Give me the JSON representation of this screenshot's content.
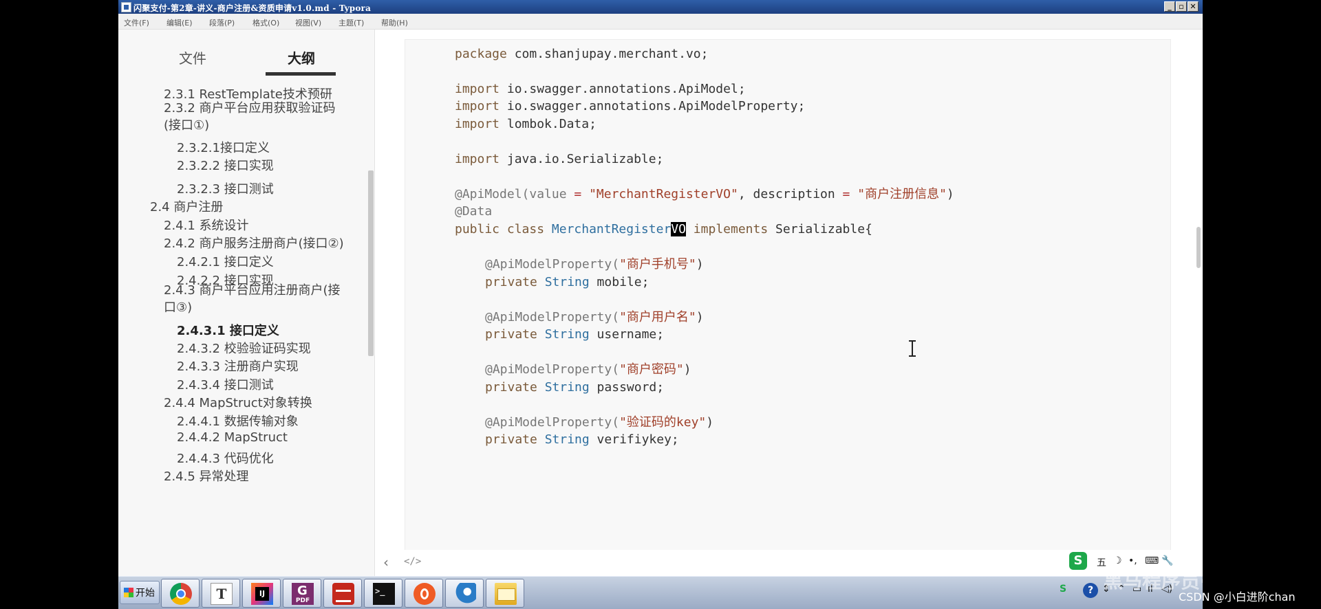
{
  "window": {
    "title": "闪聚支付-第2章-讲义-商户注册&资质申请v1.0.md - Typora",
    "controls": [
      "_",
      "▫",
      "✕"
    ]
  },
  "menu": [
    "文件(F)",
    "编辑(E)",
    "段落(P)",
    "格式(O)",
    "视图(V)",
    "主题(T)",
    "帮助(H)"
  ],
  "sidebar": {
    "tab_files": "文件",
    "tab_outline": "大纲",
    "items": [
      {
        "label": "2.3.1 RestTemplate技术预研"
      },
      {
        "label": "2.3.2 商户平台应用获取验证码(接口①)"
      },
      {
        "label": "2.3.2.1接口定义"
      },
      {
        "label": "2.3.2.2 接口实现"
      },
      {
        "label": "2.3.2.3 接口测试"
      },
      {
        "label": "2.4 商户注册"
      },
      {
        "label": "2.4.1 系统设计"
      },
      {
        "label": "2.4.2 商户服务注册商户(接口②)"
      },
      {
        "label": "2.4.2.1 接口定义"
      },
      {
        "label": "2.4.2.2 接口实现"
      },
      {
        "label": "2.4.3 商户平台应用注册商户(接口③)"
      },
      {
        "label": "2.4.3.1 接口定义",
        "active": true
      },
      {
        "label": "2.4.3.2 校验验证码实现"
      },
      {
        "label": "2.4.3.3 注册商户实现"
      },
      {
        "label": "2.4.3.4 接口测试"
      },
      {
        "label": "2.4.4 MapStruct对象转换"
      },
      {
        "label": "2.4.4.1 数据传输对象"
      },
      {
        "label": "2.4.4.2 MapStruct"
      },
      {
        "label": "2.4.4.3 代码优化"
      },
      {
        "label": "2.4.5 异常处理"
      }
    ]
  },
  "code": {
    "package_kw": "package",
    "package_name": " com.shanjupay.merchant.vo;",
    "import_kw": "import",
    "imports": [
      " io.swagger.annotations.ApiModel;",
      " io.swagger.annotations.ApiModelProperty;",
      " lombok.Data;",
      " java.io.Serializable;"
    ],
    "api_model_annotation": "@ApiModel(value ",
    "eq": "=",
    "api_model_value": "\"MerchantRegisterVO\"",
    "api_model_mid": ", description ",
    "api_model_desc": "\"商户注册信息\"",
    "close_paren": ")",
    "data_annotation": "@Data",
    "class_public": "public",
    "class_kw": " class ",
    "class_name_pre": "MerchantRegister",
    "class_name_hl": "VO",
    "class_implements": " implements",
    "class_rest": " Serializable{",
    "prop_annotation": "@ApiModelProperty(",
    "private_kw": "private",
    "string_type": " String",
    "fields": [
      {
        "desc": "\"商户手机号\"",
        "name": " mobile;"
      },
      {
        "desc": "\"商户用户名\"",
        "name": " username;"
      },
      {
        "desc": "\"商户密码\"",
        "name": " password;"
      },
      {
        "desc": "\"验证码的key\"",
        "name": " verifiykey;"
      }
    ]
  },
  "bottombar": {
    "back": "‹",
    "source_mode": "</>"
  },
  "tray": {
    "ime": "S",
    "ime_text": "五",
    "icons": [
      "☽",
      "•,",
      "⌨",
      "🔧"
    ]
  },
  "watermark": "黑马程序员·bilibili",
  "taskbar": {
    "start": "开始",
    "apps": [
      "chrome-icon",
      "typora-icon",
      "idea-icon",
      "pdf-icon",
      "redis-icon",
      "terminal-icon",
      "postman-icon",
      "mysql-icon",
      "explorer-icon"
    ],
    "typora_glyph": "T",
    "terminal_glyph": ">_",
    "pdf_glyph": "PDF"
  },
  "systray": {
    "help": "?",
    "items": [
      "S",
      "⇕",
      "⌃",
      "▭",
      "ıl",
      "◁)"
    ]
  },
  "csdn": "CSDN @小白进阶chan",
  "colors": {
    "keyword": "#7a5a3a",
    "type": "#2f6f9f",
    "string": "#a0402a",
    "annotation": "#777777",
    "titlebar": "#2f5fa8"
  }
}
